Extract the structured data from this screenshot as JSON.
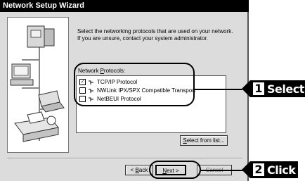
{
  "window": {
    "title": "Network Setup Wizard"
  },
  "instructions": {
    "line1": "Select the networking protocols that are used on your network.",
    "line2": "If you are unsure, contact your system administrator."
  },
  "protocols": {
    "label_prefix": "Network ",
    "label_underlined": "P",
    "label_suffix": "rotocols:",
    "items": [
      {
        "label": "TCP/IP Protocol",
        "checked": true,
        "check_mark": "✓"
      },
      {
        "label": "NWLink IPX/SPX Compatible Transport",
        "checked": false,
        "check_mark": ""
      },
      {
        "label": "NetBEUI Protocol",
        "checked": false,
        "check_mark": ""
      }
    ]
  },
  "buttons": {
    "select_from_list_u": "S",
    "select_from_list_rest": "elect from list...",
    "back_prefix": "< ",
    "back_u": "B",
    "back_rest": "ack",
    "next_u": "N",
    "next_rest": "ext >",
    "cancel": "Cancel"
  },
  "callouts": {
    "step1": {
      "number": "1",
      "word": "Select"
    },
    "step2": {
      "number": "2",
      "word": "Click"
    }
  }
}
